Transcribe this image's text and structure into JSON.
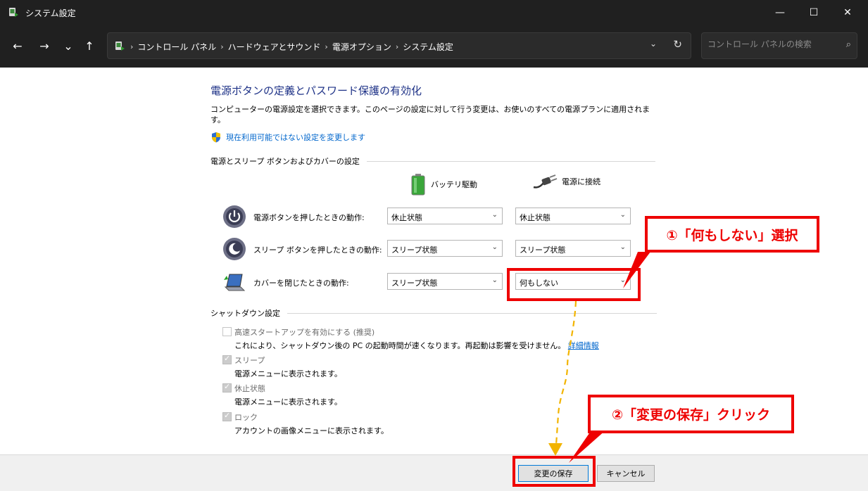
{
  "window": {
    "title": "システム設定",
    "controls": {
      "minimize": "—",
      "maximize": "☐",
      "close": "✕"
    }
  },
  "nav": {
    "back": "←",
    "forward": "→",
    "recent": "⌄",
    "up": "↑",
    "breadcrumbs": [
      "コントロール パネル",
      "ハードウェアとサウンド",
      "電源オプション",
      "システム設定"
    ],
    "search_placeholder": "コントロール パネルの検索"
  },
  "page": {
    "heading": "電源ボタンの定義とパスワード保護の有効化",
    "description": "コンピューターの電源設定を選択できます。このページの設定に対して行う変更は、お使いのすべての電源プランに適用されます。",
    "change_unavailable_link": "現在利用可能ではない設定を変更します",
    "section_power": "電源とスリープ ボタンおよびカバーの設定",
    "col_battery": "バッテリ駆動",
    "col_plugged": "電源に接続",
    "rows": [
      {
        "label": "電源ボタンを押したときの動作:",
        "battery": "休止状態",
        "plugged": "休止状態"
      },
      {
        "label": "スリープ ボタンを押したときの動作:",
        "battery": "スリープ状態",
        "plugged": "スリープ状態"
      },
      {
        "label": "カバーを閉じたときの動作:",
        "battery": "スリープ状態",
        "plugged": "何もしない"
      }
    ],
    "section_shutdown": "シャットダウン設定",
    "shutdown_items": [
      {
        "label": "高速スタートアップを有効にする (推奨)",
        "checked": false,
        "desc": "これにより、シャットダウン後の PC の起動時間が速くなります。再起動は影響を受けません。",
        "link": "詳細情報"
      },
      {
        "label": "スリープ",
        "checked": true,
        "desc": "電源メニューに表示されます。"
      },
      {
        "label": "休止状態",
        "checked": true,
        "desc": "電源メニューに表示されます。"
      },
      {
        "label": "ロック",
        "checked": true,
        "desc": "アカウントの画像メニューに表示されます。"
      }
    ]
  },
  "footer": {
    "save_label": "変更の保存",
    "cancel_label": "キャンセル"
  },
  "annotations": {
    "step1": "①「何もしない」選択",
    "step2": "②「変更の保存」クリック",
    "color": "#e00000",
    "arrow_color": "#f2b400"
  }
}
